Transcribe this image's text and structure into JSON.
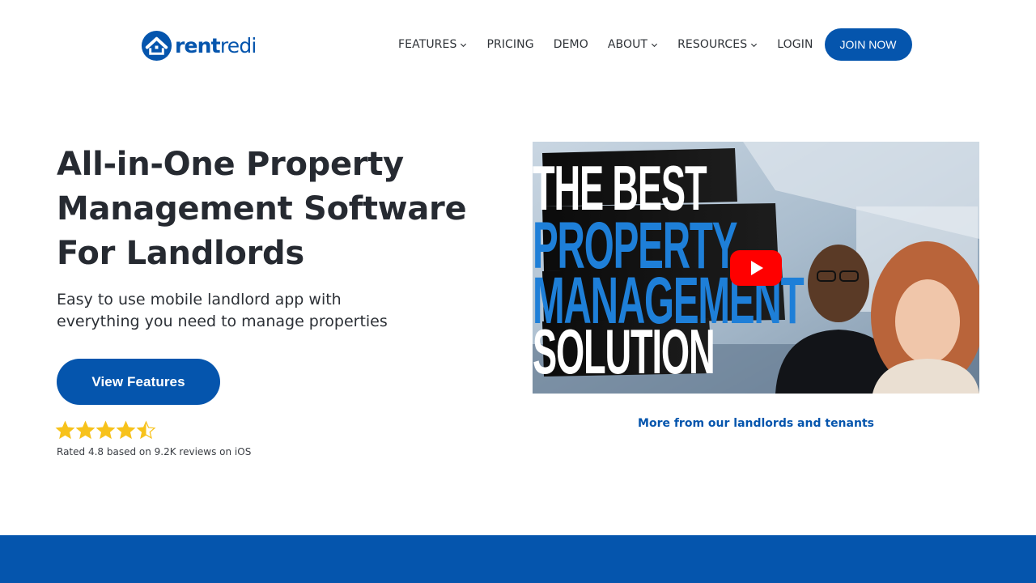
{
  "brand": {
    "name_bold": "rent",
    "name_light": "redi",
    "color": "#0555ad"
  },
  "nav": {
    "features": "FEATURES",
    "pricing": "PRICING",
    "demo": "DEMO",
    "about": "ABOUT",
    "resources": "RESOURCES",
    "login": "LOGIN",
    "join": "JOIN NOW"
  },
  "hero": {
    "title_line1": "All-in-One Property",
    "title_line2": "Management Software",
    "title_line3": "For Landlords",
    "subtitle_line1": "Easy to use mobile landlord app with",
    "subtitle_line2": "everything you need to manage properties",
    "cta": "View Features",
    "rating_value": 4.5,
    "rating_text": "Rated 4.8 based on 9.2K reviews on iOS"
  },
  "video": {
    "line1": "THE BEST",
    "line2": "PROPERTY",
    "line3": "MANAGEMENT",
    "line4": "SOLUTION",
    "more_link": "More from our landlords and tenants"
  },
  "colors": {
    "star": "#f7c21b",
    "youtube_red": "#ff0000",
    "video_blue": "#1e7fd8"
  }
}
